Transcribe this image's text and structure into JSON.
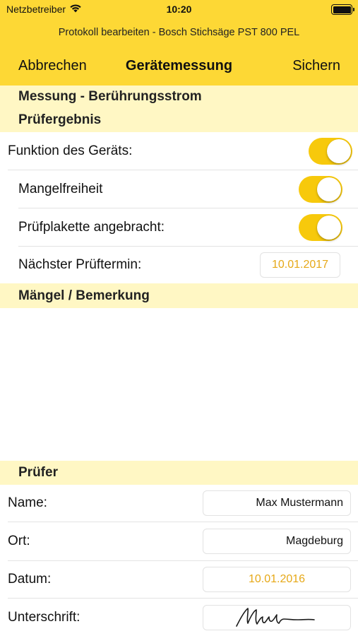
{
  "status": {
    "carrier": "Netzbetreiber",
    "time": "10:20"
  },
  "header": {
    "subtitle": "Protokoll bearbeiten - Bosch Stichsäge PST 800 PEL",
    "cancel_label": "Abbrechen",
    "title": "Gerätemessung",
    "save_label": "Sichern"
  },
  "sections": {
    "measurement": "Messung - Berührungsstrom",
    "result": "Prüfergebnis",
    "defects": "Mängel / Bemerkung",
    "inspector": "Prüfer"
  },
  "result": {
    "function_label": "Funktion des Geräts:",
    "function_on": true,
    "defect_free_label": "Mangelfreiheit",
    "defect_free_on": true,
    "sticker_label": "Prüfplakette angebracht:",
    "sticker_on": true,
    "next_date_label": "Nächster Prüftermin:",
    "next_date_value": "10.01.2017"
  },
  "defects": {
    "text": ""
  },
  "inspector": {
    "name_label": "Name:",
    "name_value": "Max Mustermann",
    "place_label": "Ort:",
    "place_value": "Magdeburg",
    "date_label": "Datum:",
    "date_value": "10.01.2016",
    "signature_label": "Unterschrift:"
  },
  "colors": {
    "accent": "#FDD835",
    "section_bg": "#FFF7C4",
    "toggle_on": "#F7C90C",
    "date_text": "#E6A817"
  }
}
